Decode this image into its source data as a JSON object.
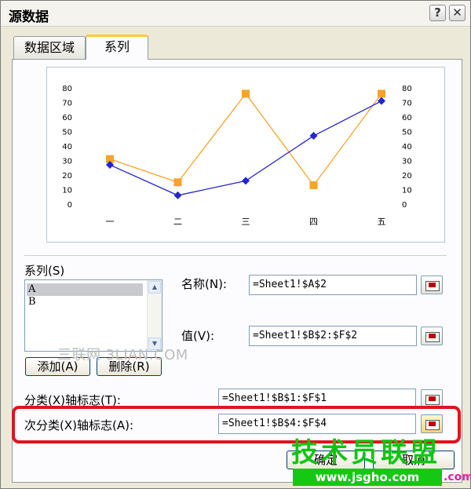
{
  "window": {
    "title": "源数据"
  },
  "title_buttons": {
    "help": "?",
    "close": "✕"
  },
  "tabs": [
    {
      "label": "数据区域",
      "active": false
    },
    {
      "label": "系列",
      "active": true
    }
  ],
  "chart_data": {
    "type": "line",
    "categories": [
      "一",
      "二",
      "三",
      "四",
      "五"
    ],
    "ylim": [
      0,
      80
    ],
    "y_ticks": [
      "0",
      "10",
      "20",
      "30",
      "40",
      "50",
      "60",
      "70",
      "80"
    ],
    "secondary_ylim": [
      0,
      80
    ],
    "series": [
      {
        "values": [
          27,
          6,
          16,
          47,
          71
        ],
        "color": "#2323d8",
        "marker": "diamond"
      },
      {
        "values": [
          31,
          15,
          76,
          13,
          76
        ],
        "color": "#f7a32b",
        "marker": "square"
      }
    ]
  },
  "series_panel": {
    "list_label": "系列(S)",
    "items": [
      "A",
      "B"
    ],
    "selected": "A",
    "add_button": "添加(A)",
    "delete_button": "删除(R)"
  },
  "name_field": {
    "label": "名称(N):",
    "value": "=Sheet1!$A$2"
  },
  "values_field": {
    "label": "值(V):",
    "value": "=Sheet1!$B$2:$F$2"
  },
  "category_labels": {
    "label": "分类(X)轴标志(T):",
    "value": "=Sheet1!$B$1:$F$1"
  },
  "secondary_category_labels": {
    "label": "次分类(X)轴标志(A):",
    "value": "=Sheet1!$B$4:$F$4"
  },
  "footer_buttons": {
    "ok": "确定",
    "cancel": "取消"
  },
  "watermark": "三联网 3LIAN.COM",
  "site_logo": {
    "text": "技术员联盟",
    "url": "www.jsgho.com",
    "suffix": ".com"
  },
  "colors": {
    "highlight": "#e0141e",
    "tab_accent": "#ffc83c",
    "logo_green": "#14c814"
  }
}
